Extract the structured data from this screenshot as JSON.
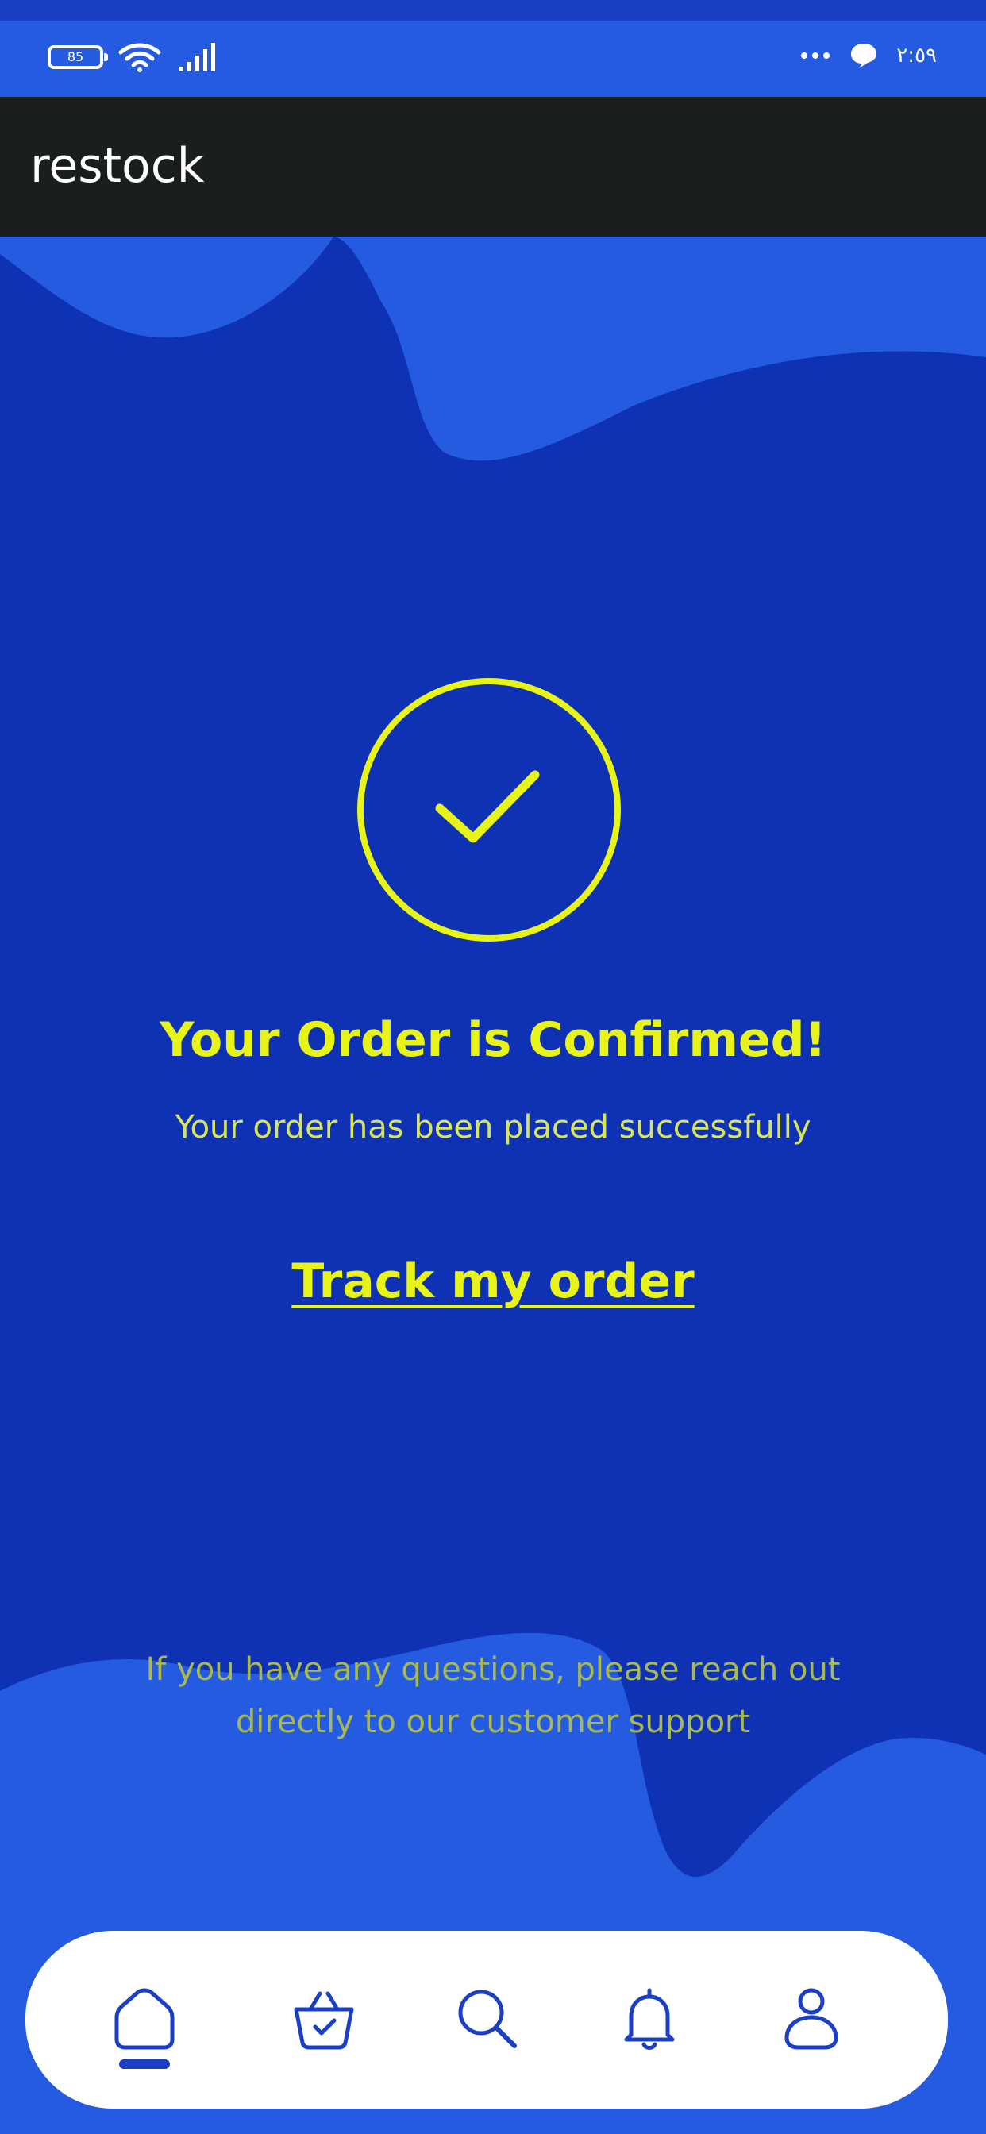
{
  "status_bar": {
    "battery_level": "85",
    "time": "٢:٥٩",
    "icons": [
      "battery-icon",
      "wifi-icon",
      "signal-icon",
      "more-dots-icon",
      "chat-bubble-icon"
    ]
  },
  "app_bar": {
    "title": "restock"
  },
  "confirmation": {
    "icon": "check-circle-icon",
    "title": "Your Order is Confirmed!",
    "subtitle": "Your order has been placed successfully",
    "track_link_label": "Track my order",
    "support_note": "If you have any questions, please reach out directly to our customer support"
  },
  "bottom_nav": {
    "items": [
      {
        "icon": "home-icon",
        "active": true
      },
      {
        "icon": "basket-icon",
        "active": false
      },
      {
        "icon": "search-icon",
        "active": false
      },
      {
        "icon": "bell-icon",
        "active": false
      },
      {
        "icon": "profile-icon",
        "active": false
      }
    ]
  },
  "colors": {
    "background": "#0f32b4",
    "blob": "#245be0",
    "accent_yellow": "#e8f418",
    "app_bar": "#1b1e1e",
    "nav_background": "#ffffff",
    "nav_icon": "#1a3fc4"
  }
}
